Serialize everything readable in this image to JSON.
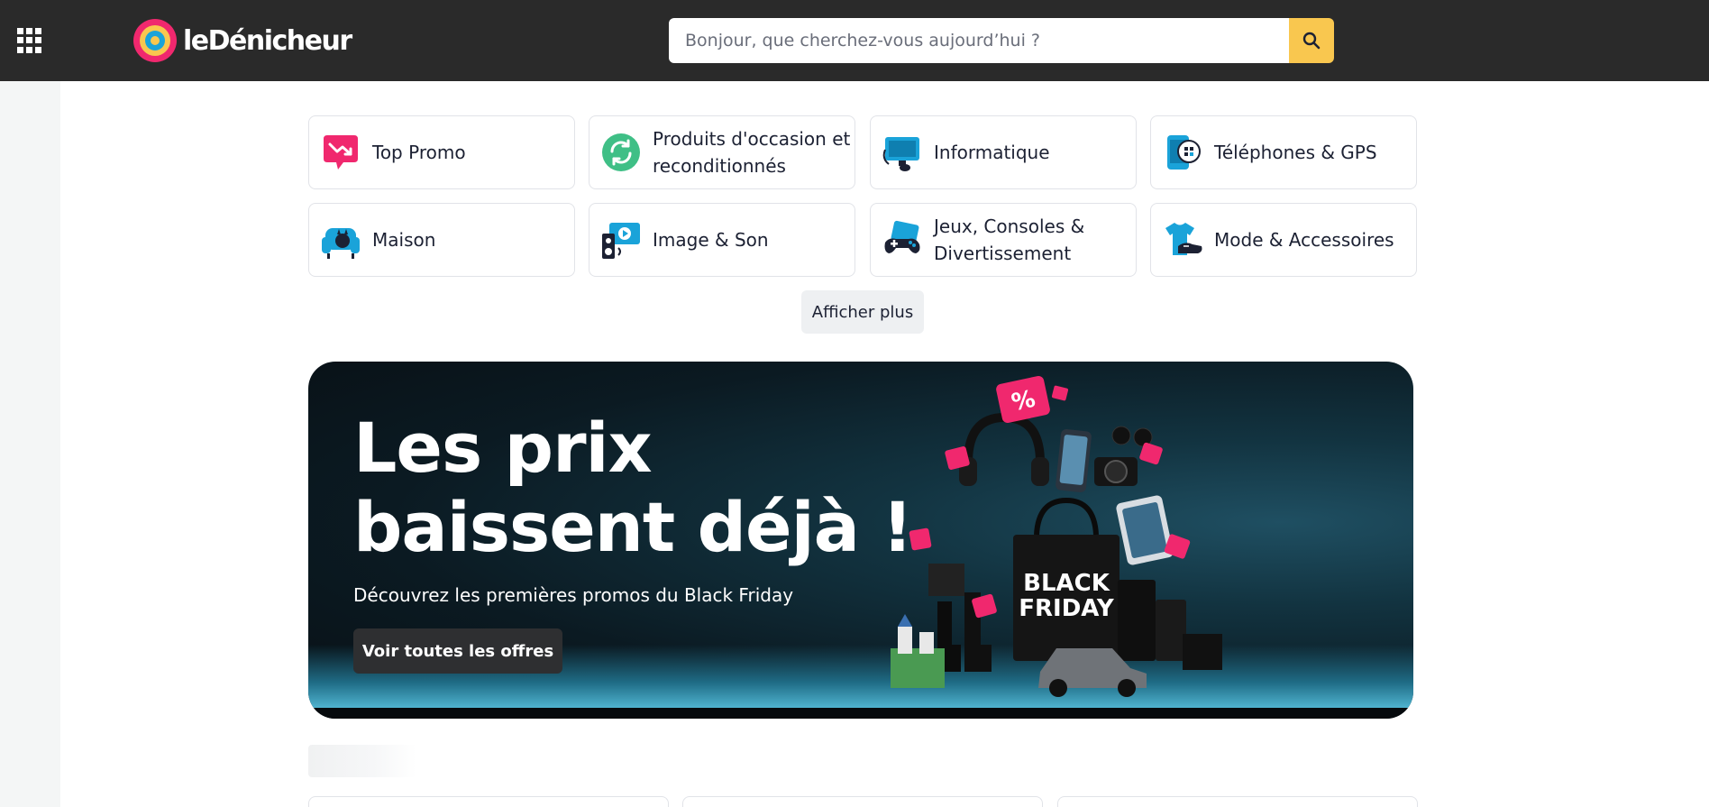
{
  "header": {
    "brand": "leDénicheur",
    "search_placeholder": "Bonjour, que cherchez-vous aujourd’hui ?"
  },
  "categories": [
    {
      "label": "Top Promo",
      "icon": "top-promo-icon"
    },
    {
      "label": "Produits d'occasion et reconditionnés",
      "icon": "refurbished-icon"
    },
    {
      "label": "Informatique",
      "icon": "computer-icon"
    },
    {
      "label": "Téléphones & GPS",
      "icon": "phone-icon"
    },
    {
      "label": "Maison",
      "icon": "home-armchair-icon"
    },
    {
      "label": "Image & Son",
      "icon": "image-sound-icon"
    },
    {
      "label": "Jeux, Consoles & Divertissement",
      "icon": "gamepad-icon"
    },
    {
      "label": "Mode & Accessoires",
      "icon": "fashion-icon"
    }
  ],
  "show_more_label": "Afficher plus",
  "banner": {
    "title": "Les prix baissent déjà !",
    "subtitle": "Découvrez les premières promos du Black Friday",
    "cta": "Voir toutes les offres",
    "bag_text_line1": "BLACK",
    "bag_text_line2": "FRIDAY",
    "promo_tag": "%"
  },
  "colors": {
    "header_bg": "#2a2a2a",
    "search_button": "#f9c74f",
    "accent_pink": "#f0286e",
    "category_blue": "#1aa3d9",
    "refurbished_green": "#3fbf86"
  }
}
